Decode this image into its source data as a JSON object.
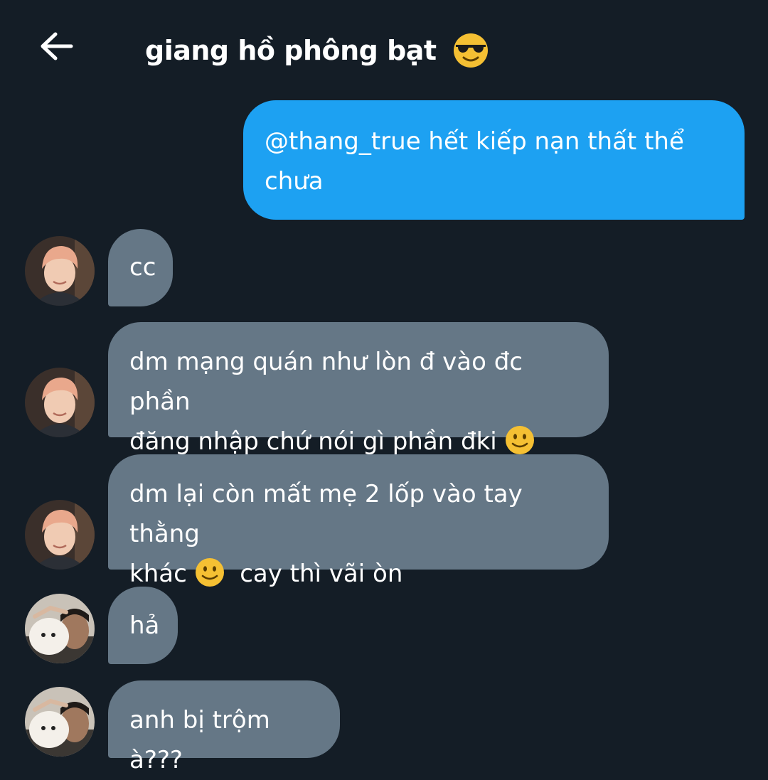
{
  "header": {
    "title": "giang hồ phông bạt",
    "back_icon": "arrow-left-icon",
    "title_emoji": "smiling-face-with-sunglasses-icon"
  },
  "messages": [
    {
      "from": "me",
      "lines": [
        "@thang_true hết kiếp nạn thất thể",
        "chưa"
      ]
    },
    {
      "from": "user-a",
      "lines": [
        "cc"
      ]
    },
    {
      "from": "user-a",
      "lines": [
        "dm mạng quán như lòn đ vào đc phần",
        "đăng nhập chứ nói gì phần đki"
      ],
      "emoji": "slightly-smiling-face-icon"
    },
    {
      "from": "user-a",
      "line1": "dm lại còn mất mẹ 2 lốp vào tay thằng",
      "line2_pre": "khác",
      "line2_post": " cay thì vãi òn",
      "emoji": "slightly-smiling-face-icon"
    },
    {
      "from": "user-b",
      "lines": [
        "hả"
      ]
    },
    {
      "from": "user-b",
      "lines": [
        "anh bị trộm à???"
      ]
    }
  ],
  "colors": {
    "background": "#141d26",
    "sent_bubble": "#1da1f2",
    "received_bubble": "#657786"
  }
}
